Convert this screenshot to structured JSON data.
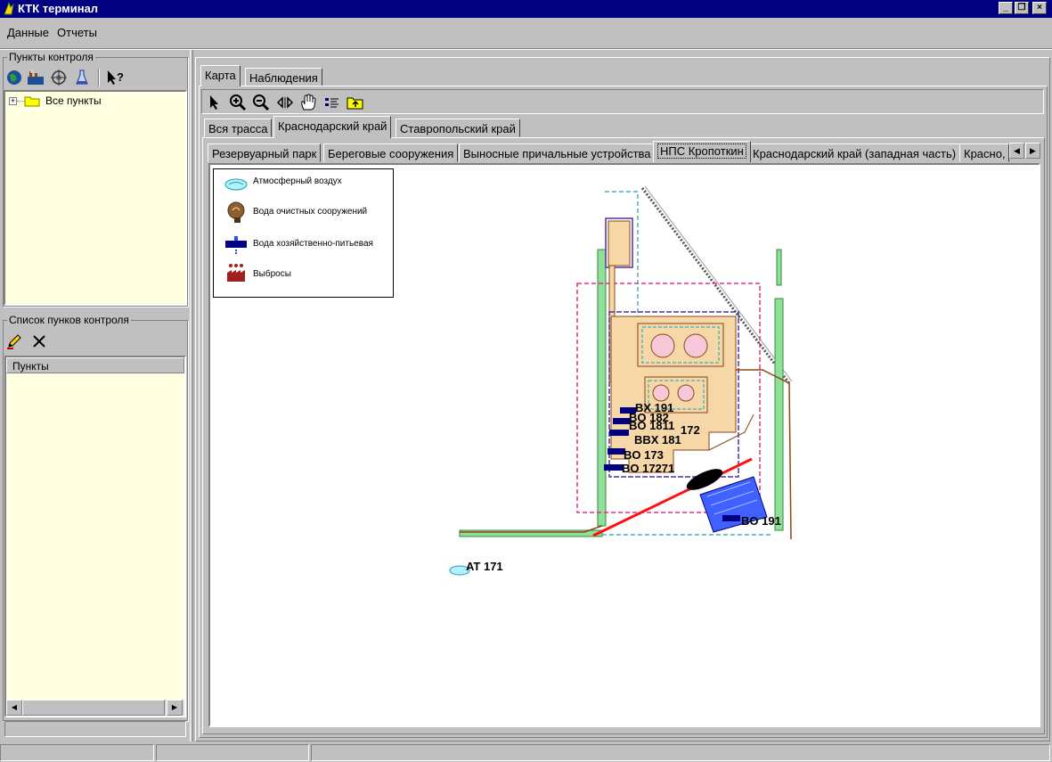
{
  "window": {
    "title": "КТК терминал"
  },
  "menu": {
    "items": [
      "Данные",
      "Отчеты"
    ]
  },
  "left": {
    "control_points_title": "Пункты контроля",
    "tree_root": "Все пункты",
    "list_title": "Список пунков контроля",
    "list_column": "Пункты"
  },
  "main": {
    "tabs": [
      "Карта",
      "Наблюдения"
    ],
    "region_tabs": [
      "Вся трасса",
      "Краснодарский край",
      "Ставропольский край"
    ],
    "site_tabs": [
      "Резервуарный парк",
      "Береговые сооружения",
      "Выносные причальные устройства",
      "НПС Кропоткин",
      "Краснодарский край (западная часть)",
      "Красно,"
    ]
  },
  "legend": {
    "items": [
      "Атмосферный воздух",
      "Вода очистных сооружений",
      "Вода хозяйственно-питьевая",
      "Выбросы"
    ]
  },
  "map_labels": {
    "bx191": "BX 191",
    "bo182": "BO 182",
    "bo1811": "BO 1811",
    "l172": "172",
    "bbx181": "BBX 181",
    "bo173": "BO 173",
    "bo17271": "BO 17271",
    "bo191": "BO 191",
    "at171": "AT 171"
  },
  "colors": {
    "titlebar": "#000080",
    "tree_bg": "#ffffe1",
    "site_fill": "#f5d7a8",
    "route": "#ff0000"
  }
}
